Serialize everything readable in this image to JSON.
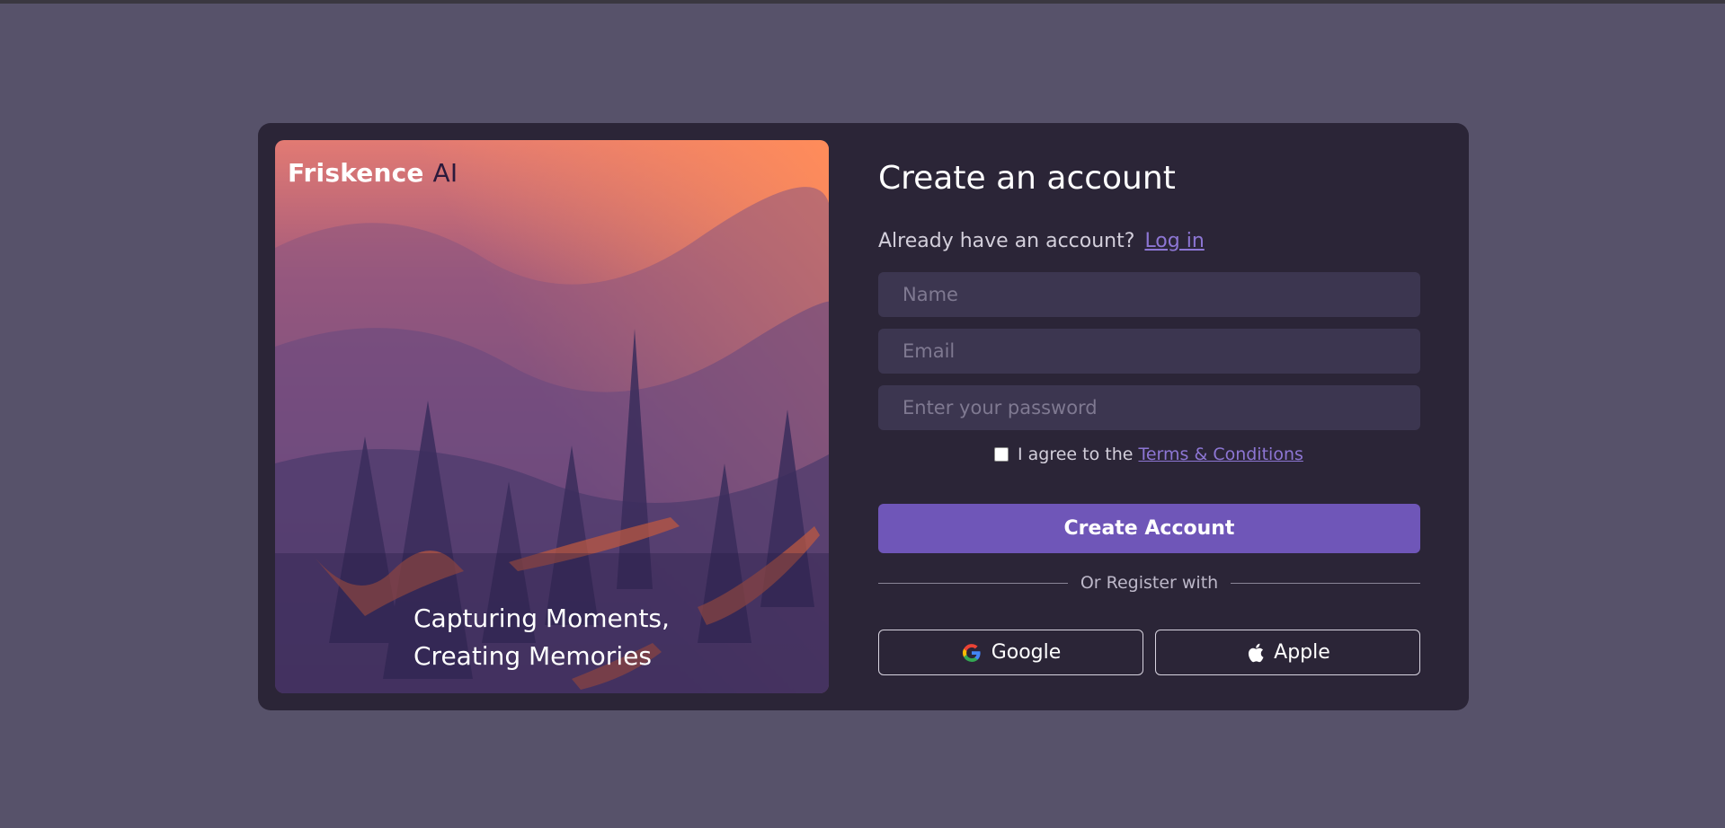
{
  "brand": {
    "name": "Friskence",
    "suffix": "AI"
  },
  "hero": {
    "tagline_line1": "Capturing Moments,",
    "tagline_line2": "Creating Memories"
  },
  "form": {
    "title": "Create an account",
    "already_text": "Already have an account?",
    "login_link": "Log in",
    "name_placeholder": "Name",
    "email_placeholder": "Email",
    "password_placeholder": "Enter your password",
    "agree_text": "I agree to the",
    "terms_link": "Terms & Conditions",
    "terms_checked": false,
    "create_button": "Create Account",
    "divider_text": "Or Register with",
    "google_label": "Google",
    "apple_label": "Apple"
  },
  "colors": {
    "page_bg": "#57526a",
    "card_bg": "#2b2537",
    "input_bg": "#3c3650",
    "accent": "#6f56b8",
    "link": "#8d76d4"
  },
  "icons": {
    "google": "google-g-icon",
    "apple": "apple-logo-icon"
  }
}
